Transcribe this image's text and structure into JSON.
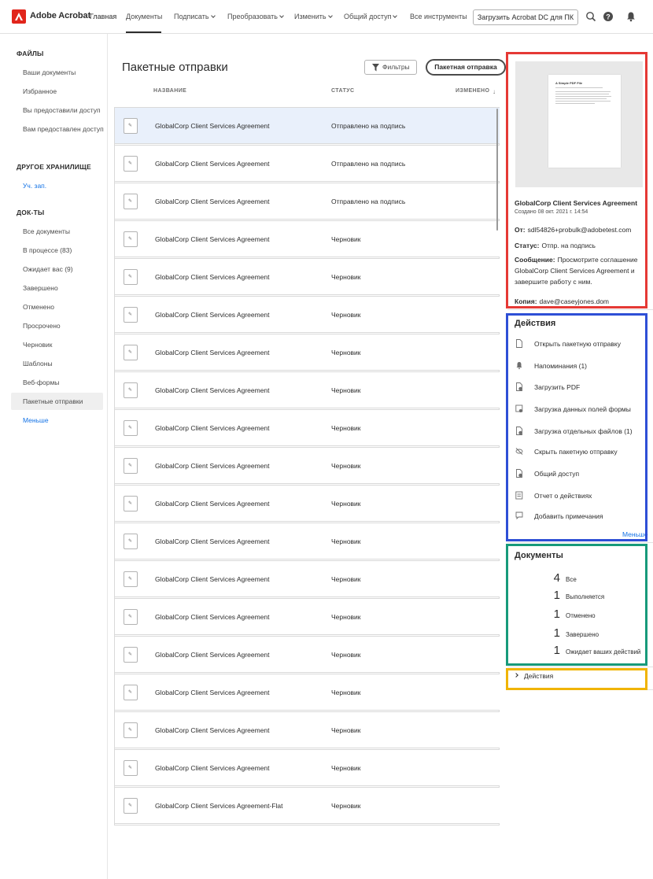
{
  "app": {
    "brand": "Adobe Acrobat",
    "brand_color": "#e1251b",
    "accent_link_color": "#1473e6"
  },
  "topnav": {
    "items": [
      {
        "label": "Главная",
        "dropdown": false
      },
      {
        "label": "Документы",
        "dropdown": false,
        "active": true
      },
      {
        "label": "Подписать",
        "dropdown": true
      },
      {
        "label": "Преобразовать",
        "dropdown": true
      },
      {
        "label": "Изменить",
        "dropdown": true
      },
      {
        "label": "Общий доступ",
        "dropdown": true
      },
      {
        "label": "Все инструменты",
        "dropdown": false
      }
    ],
    "download_button": "Загрузить Acrobat DC для ПК",
    "icons": [
      "search-icon",
      "help-icon",
      "bell-icon"
    ]
  },
  "sidebar": {
    "files_heading": "ФАЙЛЫ",
    "files": [
      "Ваши документы",
      "Избранное",
      "Вы предоставили доступ",
      "Вам предоставлен доступ"
    ],
    "storage_heading": "ДРУГОЕ ХРАНИЛИЩЕ",
    "storage_link": "Уч. зап.",
    "docs_heading": "ДОК-ТЫ",
    "docs": [
      "Все документы",
      "В процессе (83)",
      "Ожидает вас (9)",
      "Завершено",
      "Отменено",
      "Просрочено",
      "Черновик",
      "Шаблоны",
      "Веб-формы",
      "Пакетные отправки"
    ],
    "selected": "Пакетные отправки",
    "less_link": "Меньше"
  },
  "main": {
    "title": "Пакетные отправки",
    "filters_button": "Фильтры",
    "package_button": "Пакетная отправка",
    "columns": {
      "name": "НАЗВАНИЕ",
      "status": "СТАТУС",
      "modified": "ИЗМЕНЕНО"
    },
    "rows": [
      {
        "name": "GlobalCorp Client Services Agreement",
        "status": "Отправлено на подпись",
        "selected": true
      },
      {
        "name": "GlobalCorp Client Services Agreement",
        "status": "Отправлено на подпись"
      },
      {
        "name": "GlobalCorp Client Services Agreement",
        "status": "Отправлено на подпись"
      },
      {
        "name": "GlobalCorp Client Services Agreement",
        "status": "Черновик"
      },
      {
        "name": "GlobalCorp Client Services Agreement",
        "status": "Черновик"
      },
      {
        "name": "GlobalCorp Client Services Agreement",
        "status": "Черновик"
      },
      {
        "name": "GlobalCorp Client Services Agreement",
        "status": "Черновик"
      },
      {
        "name": "GlobalCorp Client Services Agreement",
        "status": "Черновик"
      },
      {
        "name": "GlobalCorp Client Services Agreement",
        "status": "Черновик"
      },
      {
        "name": "GlobalCorp Client Services Agreement",
        "status": "Черновик"
      },
      {
        "name": "GlobalCorp Client Services Agreement",
        "status": "Черновик"
      },
      {
        "name": "GlobalCorp Client Services Agreement",
        "status": "Черновик"
      },
      {
        "name": "GlobalCorp Client Services Agreement",
        "status": "Черновик"
      },
      {
        "name": "GlobalCorp Client Services Agreement",
        "status": "Черновик"
      },
      {
        "name": "GlobalCorp Client Services Agreement",
        "status": "Черновик"
      },
      {
        "name": "GlobalCorp Client Services Agreement",
        "status": "Черновик"
      },
      {
        "name": "GlobalCorp Client Services Agreement",
        "status": "Черновик"
      },
      {
        "name": "GlobalCorp Client Services Agreement",
        "status": "Черновик"
      },
      {
        "name": "GlobalCorp Client Services Agreement-Flat",
        "status": "Черновик"
      }
    ]
  },
  "details": {
    "preview_title": "A Simple PDF File",
    "title": "GlobalCorp Client Services Agreement",
    "created": "Создано 08 окт. 2021 г. 14:54",
    "from_label": "От:",
    "from_value": "sdl54826+probulk@adobetest.com",
    "status_label": "Статус:",
    "status_value": "Отпр. на подпись",
    "message_label": "Сообщение:",
    "message_value": "Просмотрите соглашение GlobalCorp Client Services Agreement и завершите работу с ним.",
    "cc_label": "Копия:",
    "cc_value": "dave@caseyjones.dom"
  },
  "actions": {
    "title": "Действия",
    "items": [
      {
        "label": "Открыть пакетную отправку",
        "icon": "document-icon"
      },
      {
        "label": "Напоминания (1)",
        "icon": "bell-icon"
      },
      {
        "label": "Загрузить PDF",
        "icon": "download-pdf-icon"
      },
      {
        "label": "Загрузка данных полей формы",
        "icon": "form-data-icon"
      },
      {
        "label": "Загрузка отдельных файлов (1)",
        "icon": "download-files-icon"
      },
      {
        "label": "Скрыть пакетную отправку",
        "icon": "hide-icon"
      },
      {
        "label": "Общий доступ",
        "icon": "share-icon"
      },
      {
        "label": "Отчет о действиях",
        "icon": "report-icon"
      },
      {
        "label": "Добавить примечания",
        "icon": "comment-icon"
      }
    ],
    "less_link": "Меньше"
  },
  "documents": {
    "title": "Документы",
    "counts": [
      {
        "count": "4",
        "label": "Все"
      },
      {
        "count": "1",
        "label": "Выполняется"
      },
      {
        "count": "1",
        "label": "Отменено"
      },
      {
        "count": "1",
        "label": "Завершено"
      },
      {
        "count": "1",
        "label": "Ожидает ваших действий"
      }
    ]
  },
  "activity": {
    "label": "Действия"
  },
  "highlight_colors": {
    "red": "#e53935",
    "blue": "#2e4fd6",
    "green": "#179a7a",
    "yellow": "#f0b400"
  }
}
